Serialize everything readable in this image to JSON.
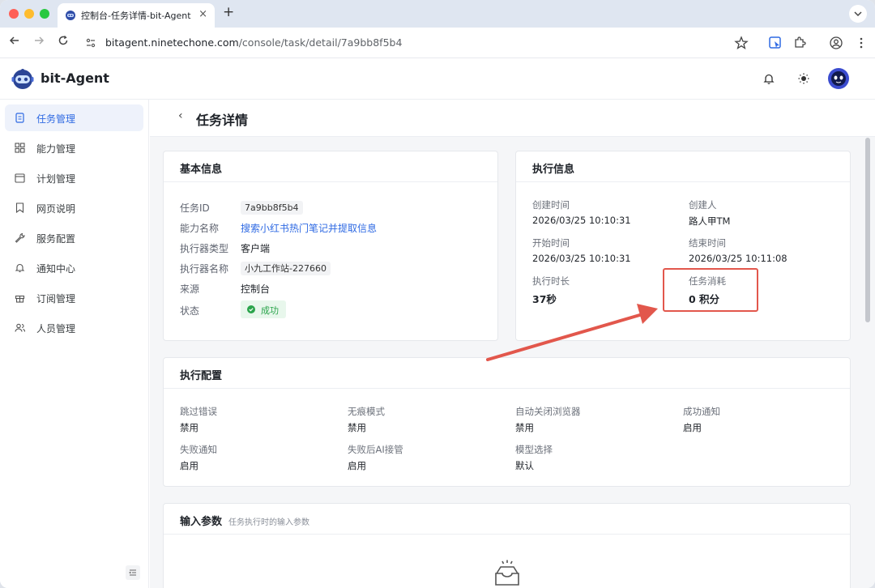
{
  "browser": {
    "tab_title": "控制台-任务详情-bit-Agent",
    "tab_close": "×",
    "new_tab": "+",
    "url_host": "bitagent.ninetechone.com",
    "url_path": "/console/task/detail/7a9bb8f5b4"
  },
  "app": {
    "brand": "bit-Agent"
  },
  "sidebar": {
    "items": [
      {
        "label": "任务管理",
        "icon": "task-icon",
        "active": true
      },
      {
        "label": "能力管理",
        "icon": "grid-icon",
        "active": false
      },
      {
        "label": "计划管理",
        "icon": "calendar-icon",
        "active": false
      },
      {
        "label": "网页说明",
        "icon": "bookmark-icon",
        "active": false
      },
      {
        "label": "服务配置",
        "icon": "wrench-icon",
        "active": false
      },
      {
        "label": "通知中心",
        "icon": "bell-icon",
        "active": false
      },
      {
        "label": "订阅管理",
        "icon": "gift-icon",
        "active": false
      },
      {
        "label": "人员管理",
        "icon": "users-icon",
        "active": false
      }
    ]
  },
  "page": {
    "back": "‹",
    "title": "任务详情"
  },
  "basic_info": {
    "title": "基本信息",
    "task_id_label": "任务ID",
    "task_id": "7a9bb8f5b4",
    "ability_label": "能力名称",
    "ability": "搜索小红书热门笔记并提取信息",
    "executor_type_label": "执行器类型",
    "executor_type": "客户端",
    "executor_name_label": "执行器名称",
    "executor_name": "小九工作站-227660",
    "source_label": "来源",
    "source": "控制台",
    "status_label": "状态",
    "status": "成功"
  },
  "exec_info": {
    "title": "执行信息",
    "created_label": "创建时间",
    "created": "2026/03/25 10:10:31",
    "creator_label": "创建人",
    "creator": "路人甲TM",
    "start_label": "开始时间",
    "start": "2026/03/25 10:10:31",
    "end_label": "结束时间",
    "end": "2026/03/25 10:11:08",
    "duration_label": "执行时长",
    "duration": "37秒",
    "cost_label": "任务消耗",
    "cost": "0 积分"
  },
  "exec_config": {
    "title": "执行配置",
    "items": [
      {
        "label": "跳过错误",
        "value": "禁用"
      },
      {
        "label": "无痕模式",
        "value": "禁用"
      },
      {
        "label": "自动关闭浏览器",
        "value": "禁用"
      },
      {
        "label": "成功通知",
        "value": "启用"
      },
      {
        "label": "失败通知",
        "value": "启用"
      },
      {
        "label": "失败后AI接管",
        "value": "启用"
      },
      {
        "label": "模型选择",
        "value": "默认"
      }
    ]
  },
  "input_params": {
    "title": "输入参数",
    "subtitle": "任务执行时的输入参数"
  },
  "colors": {
    "accent": "#2f6ae3",
    "success": "#2aa44b",
    "annotation": "#e2574c"
  }
}
